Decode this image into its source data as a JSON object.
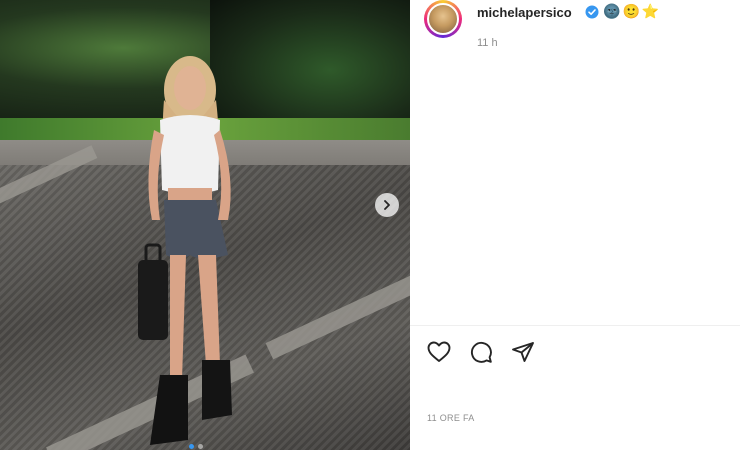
{
  "post": {
    "username": "michelapersico",
    "emojis": [
      "🌚",
      "🙂",
      "⭐"
    ],
    "time_short": "11 h",
    "time_long": "11 ORE FA",
    "carousel": {
      "count": 2,
      "active_index": 0
    }
  },
  "icons": {
    "verified": "verified-badge-icon",
    "next": "chevron-right-icon",
    "like": "heart-icon",
    "comment": "comment-icon",
    "share": "share-icon"
  },
  "colors": {
    "verified": "#3797f0",
    "text": "#262626",
    "muted": "#8e8e8e"
  }
}
